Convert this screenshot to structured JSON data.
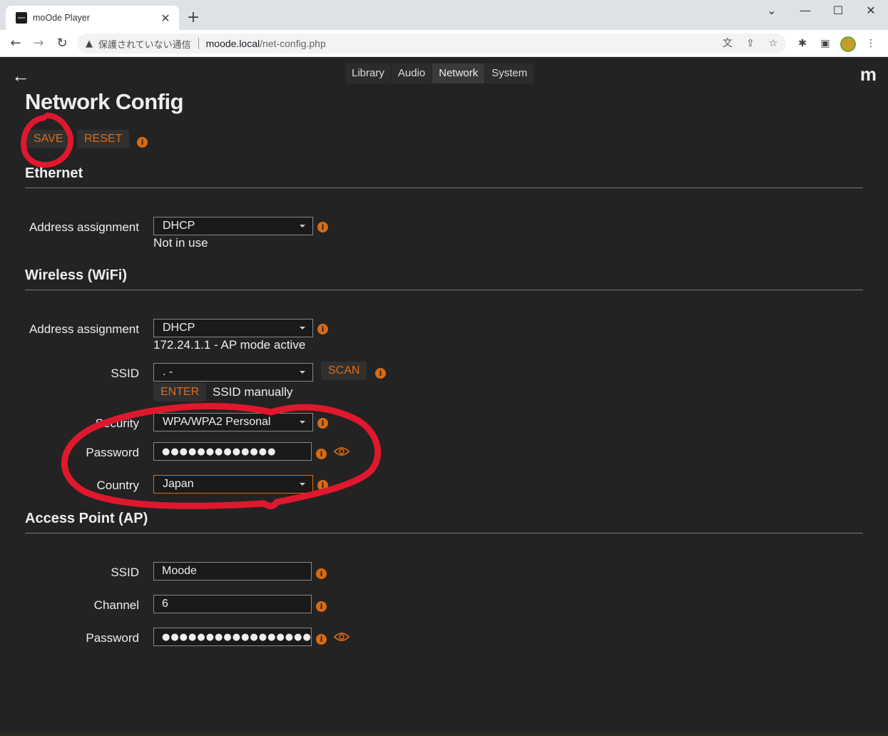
{
  "browser": {
    "tab_title": "moOde Player",
    "tab_close": "✕",
    "new_tab": "+",
    "window_controls": [
      "⌄",
      "—",
      "☐",
      "✕"
    ],
    "security_label": "保護されていない通信",
    "url_host": "moode.local",
    "url_path": "/net-config.php"
  },
  "app": {
    "brand": "m",
    "nav": {
      "library": "Library",
      "audio": "Audio",
      "network": "Network",
      "system": "System"
    },
    "page_title": "Network Config",
    "actions": {
      "save": "SAVE",
      "reset": "RESET"
    },
    "info_glyph": "i"
  },
  "ethernet": {
    "title": "Ethernet",
    "address_label": "Address assignment",
    "address_value": "DHCP",
    "status": "Not in use"
  },
  "wireless": {
    "title": "Wireless (WiFi)",
    "address_label": "Address assignment",
    "address_value": "DHCP",
    "status": "172.24.1.1 - AP mode active",
    "ssid_label": "SSID",
    "ssid_value": ".      -",
    "scan": "SCAN",
    "enter": "ENTER",
    "enter_suffix": "SSID manually",
    "security_label": "Security",
    "security_value": "WPA/WPA2 Personal",
    "password_label": "Password",
    "password_value": "●●●●●●●●●●●●●",
    "country_label": "Country",
    "country_value": "Japan"
  },
  "ap": {
    "title": "Access Point (AP)",
    "ssid_label": "SSID",
    "ssid_value": "Moode",
    "channel_label": "Channel",
    "channel_value": "6",
    "password_label": "Password",
    "password_value": "●●●●●●●●●●●●●●●●●●●●●●●●"
  },
  "colors": {
    "accent": "#e06a12",
    "annotation": "#e0182d",
    "background": "#232323"
  }
}
